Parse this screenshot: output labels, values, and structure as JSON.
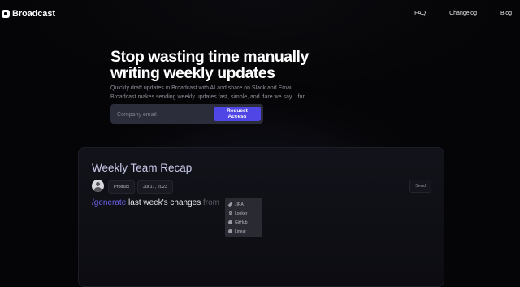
{
  "nav": {
    "brand": "Broadcast",
    "links": [
      "FAQ",
      "Changelog",
      "Blog"
    ]
  },
  "hero": {
    "title_line1": "Stop wasting time manually",
    "title_line2": "writing weekly updates",
    "subtitle_line1": "Quickly draft updates in Broadcast with AI and share on Slack and Email.",
    "subtitle_line2": "Broadcast makes sending weekly updates fast, simple, and dare we say... fun.",
    "email_placeholder": "Company email",
    "email_value": "",
    "cta_label": "Request Access"
  },
  "card": {
    "title": "Weekly Team Recap",
    "tag": "Product",
    "date": "Jul 17, 2023",
    "send_label": "Send",
    "prompt": {
      "command": "/generate",
      "text": "last week's changes",
      "from": "from"
    },
    "sources": [
      {
        "label": "JIRA",
        "icon": "jira-icon"
      },
      {
        "label": "Looker",
        "icon": "looker-icon"
      },
      {
        "label": "GitHub",
        "icon": "github-icon"
      },
      {
        "label": "Linear",
        "icon": "linear-icon"
      }
    ]
  },
  "colors": {
    "background": "#050507",
    "accent": "#4f46e5",
    "command": "#6d64e8"
  }
}
